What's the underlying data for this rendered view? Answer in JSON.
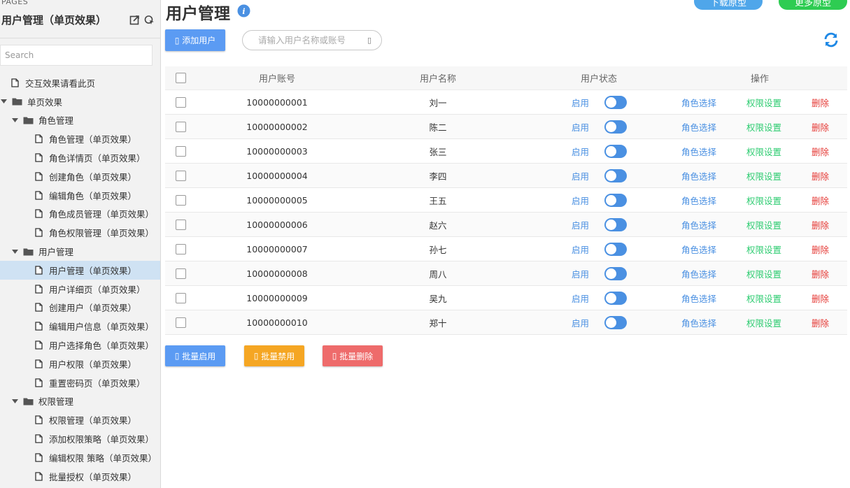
{
  "sidebar": {
    "section_label": "PAGES",
    "title": "用户管理（单页效果）",
    "search_placeholder": "Search",
    "tree": [
      {
        "label": "交互效果请看此页",
        "type": "page",
        "level": 0
      },
      {
        "label": "单页效果",
        "type": "folder",
        "level": 0,
        "expanded": true
      },
      {
        "label": "角色管理",
        "type": "folder",
        "level": 1,
        "expanded": true
      },
      {
        "label": "角色管理（单页效果）",
        "type": "page",
        "level": 2
      },
      {
        "label": "角色详情页（单页效果）",
        "type": "page",
        "level": 2
      },
      {
        "label": "创建角色（单页效果）",
        "type": "page",
        "level": 2
      },
      {
        "label": "编辑角色（单页效果）",
        "type": "page",
        "level": 2
      },
      {
        "label": "角色成员管理（单页效果）",
        "type": "page",
        "level": 2
      },
      {
        "label": "角色权限管理（单页效果）",
        "type": "page",
        "level": 2
      },
      {
        "label": "用户管理",
        "type": "folder",
        "level": 1,
        "expanded": true
      },
      {
        "label": "用户管理（单页效果）",
        "type": "page",
        "level": 2,
        "selected": true
      },
      {
        "label": "用户详细页（单页效果）",
        "type": "page",
        "level": 2
      },
      {
        "label": "创建用户（单页效果）",
        "type": "page",
        "level": 2
      },
      {
        "label": "编辑用户信息（单页效果）",
        "type": "page",
        "level": 2
      },
      {
        "label": "用户选择角色（单页效果）",
        "type": "page",
        "level": 2
      },
      {
        "label": "用户权限（单页效果）",
        "type": "page",
        "level": 2
      },
      {
        "label": "重置密码页（单页效果）",
        "type": "page",
        "level": 2
      },
      {
        "label": "权限管理",
        "type": "folder",
        "level": 1,
        "expanded": true
      },
      {
        "label": "权限管理（单页效果）",
        "type": "page",
        "level": 2
      },
      {
        "label": "添加权限策略（单页效果）",
        "type": "page",
        "level": 2
      },
      {
        "label": "编辑权限 策略（单页效果）",
        "type": "page",
        "level": 2
      },
      {
        "label": "批量授权（单页效果）",
        "type": "page",
        "level": 2
      }
    ]
  },
  "header": {
    "title": "用户管理",
    "download_label": "下载原型",
    "more_label": "更多原型"
  },
  "toolbar": {
    "add_label": "添加用户",
    "search_placeholder": "请输入用户名称或账号"
  },
  "table": {
    "headers": {
      "account": "用户账号",
      "name": "用户名称",
      "status": "用户状态",
      "ops": "操作"
    },
    "rows": [
      {
        "account": "10000000001",
        "name": "刘一",
        "status": "启用",
        "role": "角色选择",
        "perm": "权限设置",
        "del": "删除"
      },
      {
        "account": "10000000002",
        "name": "陈二",
        "status": "启用",
        "role": "角色选择",
        "perm": "权限设置",
        "del": "删除"
      },
      {
        "account": "10000000003",
        "name": "张三",
        "status": "启用",
        "role": "角色选择",
        "perm": "权限设置",
        "del": "删除"
      },
      {
        "account": "10000000004",
        "name": "李四",
        "status": "启用",
        "role": "角色选择",
        "perm": "权限设置",
        "del": "删除"
      },
      {
        "account": "10000000005",
        "name": "王五",
        "status": "启用",
        "role": "角色选择",
        "perm": "权限设置",
        "del": "删除"
      },
      {
        "account": "10000000006",
        "name": "赵六",
        "status": "启用",
        "role": "角色选择",
        "perm": "权限设置",
        "del": "删除"
      },
      {
        "account": "10000000007",
        "name": "孙七",
        "status": "启用",
        "role": "角色选择",
        "perm": "权限设置",
        "del": "删除"
      },
      {
        "account": "10000000008",
        "name": "周八",
        "status": "启用",
        "role": "角色选择",
        "perm": "权限设置",
        "del": "删除"
      },
      {
        "account": "10000000009",
        "name": "吴九",
        "status": "启用",
        "role": "角色选择",
        "perm": "权限设置",
        "del": "删除"
      },
      {
        "account": "10000000010",
        "name": "郑十",
        "status": "启用",
        "role": "角色选择",
        "perm": "权限设置",
        "del": "删除"
      }
    ]
  },
  "bulk": {
    "enable_label": "批量启用",
    "disable_label": "批量禁用",
    "delete_label": "批量删除"
  },
  "colors": {
    "primary": "#5b9bf3",
    "link_blue": "#4a90e2",
    "link_green": "#2ecc71",
    "danger": "#e53935",
    "warning": "#f5a623",
    "download": "#4fa6ea",
    "more": "#2ecc52",
    "selected_row": "#cfe2f3"
  },
  "icons": {
    "page": "file-icon",
    "folder": "folder-icon",
    "expand": "caret-down-icon",
    "info": "info-icon",
    "refresh": "refresh-icon"
  }
}
